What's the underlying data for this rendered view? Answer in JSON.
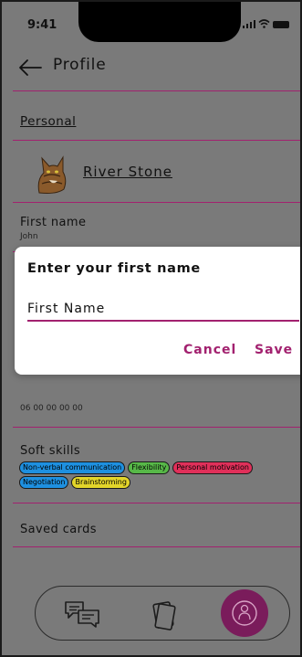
{
  "status_bar": {
    "time": "9:41"
  },
  "header": {
    "title": "Profile"
  },
  "personal_section": {
    "label": "Personal"
  },
  "profile": {
    "name": "River Stone"
  },
  "first_name_field": {
    "label": "First name",
    "value": "John"
  },
  "phone_field": {
    "value": "06 00 00 00 00"
  },
  "soft_skills": {
    "label": "Soft skills",
    "chips": [
      {
        "label": "Non-verbal communication",
        "color": "#1e90e0"
      },
      {
        "label": "Flexibility",
        "color": "#57b848"
      },
      {
        "label": "Personal motivation",
        "color": "#e0305a"
      },
      {
        "label": "Negotiation",
        "color": "#1e90e0"
      },
      {
        "label": "Brainstorming",
        "color": "#e3d52a"
      }
    ]
  },
  "saved_cards": {
    "label": "Saved cards"
  },
  "dialog": {
    "title": "Enter your first name",
    "input_placeholder": "First Name",
    "cancel_label": "Cancel",
    "save_label": "Save"
  },
  "bottom_nav": {
    "items": [
      {
        "icon": "chat-bubbles-icon"
      },
      {
        "icon": "cards-icon"
      },
      {
        "icon": "profile-icon",
        "active": true
      }
    ]
  },
  "colors": {
    "accent": "#a2216f",
    "overlay": "#7a7a7a",
    "active_nav": "#7a1c5b"
  }
}
